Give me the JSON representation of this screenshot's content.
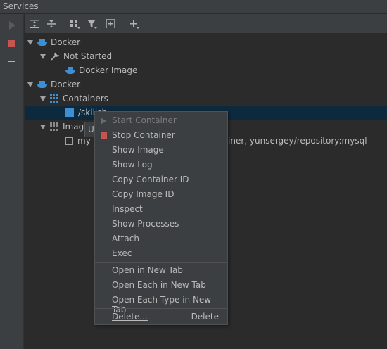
{
  "window": {
    "title": "Services"
  },
  "tree": {
    "docker1": "Docker",
    "not_started": "Not Started",
    "docker_image": "Docker Image",
    "docker2": "Docker",
    "containers": "Containers",
    "container_item": "/skillsh...",
    "images": "Imag",
    "image_item_prefix": "my",
    "image_item_suffix": "iner, yunsergey/repository:mysql"
  },
  "tooltip": {
    "text": "U"
  },
  "menu": {
    "items": [
      {
        "label": "Start Container",
        "enabled": false,
        "icon": "play-icon"
      },
      {
        "label": "Stop Container",
        "enabled": true,
        "icon": "stop-icon"
      },
      {
        "label": "Show Image",
        "enabled": true
      },
      {
        "label": "Show Log",
        "enabled": true
      },
      {
        "label": "Copy Container ID",
        "enabled": true
      },
      {
        "label": "Copy Image ID",
        "enabled": true
      },
      {
        "label": "Inspect",
        "enabled": true
      },
      {
        "label": "Show Processes",
        "enabled": true
      },
      {
        "label": "Attach",
        "enabled": true
      },
      {
        "label": "Exec",
        "enabled": true
      },
      {
        "label": "Open in New Tab",
        "enabled": true
      },
      {
        "label": "Open Each in New Tab",
        "enabled": true
      },
      {
        "label": "Open Each Type in New Tab",
        "enabled": true
      },
      {
        "label": "Delete...",
        "enabled": true,
        "shortcut": "Delete"
      }
    ]
  },
  "colors": {
    "background": "#2b2b2b",
    "panel": "#3c3f41",
    "selection": "#0d293e",
    "accent_blue": "#3d8fd1",
    "stop_red": "#c75450"
  }
}
